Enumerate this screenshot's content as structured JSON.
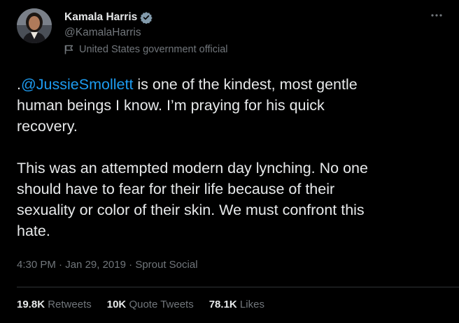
{
  "author": {
    "name": "Kamala Harris",
    "handle": "@KamalaHarris",
    "label": "United States government official"
  },
  "tweet": {
    "prefix": ".",
    "mention": "@JussieSmollett",
    "text_after_mention": " is one of the kindest, most gentle\nhuman beings I know. I’m praying for his quick\nrecovery.\n\nThis was an attempted modern day lynching. No one\nshould have to fear for their life because of their\nsexuality or color of their skin. We must confront this\nhate.",
    "time": "4:30 PM",
    "separator": "·",
    "date": "Jan 29, 2019",
    "source": "Sprout Social"
  },
  "stats": {
    "retweets_count": "19.8K",
    "retweets_label": "Retweets",
    "quotes_count": "10K",
    "quotes_label": "Quote Tweets",
    "likes_count": "78.1K",
    "likes_label": "Likes"
  },
  "icons": {
    "more": "more-options-icon",
    "verified": "verified-badge-icon",
    "official": "government-flag-icon"
  },
  "colors": {
    "background": "#000000",
    "text": "#e7e9ea",
    "secondary": "#71767b",
    "link": "#1d9bf0",
    "divider": "#2f3336"
  }
}
